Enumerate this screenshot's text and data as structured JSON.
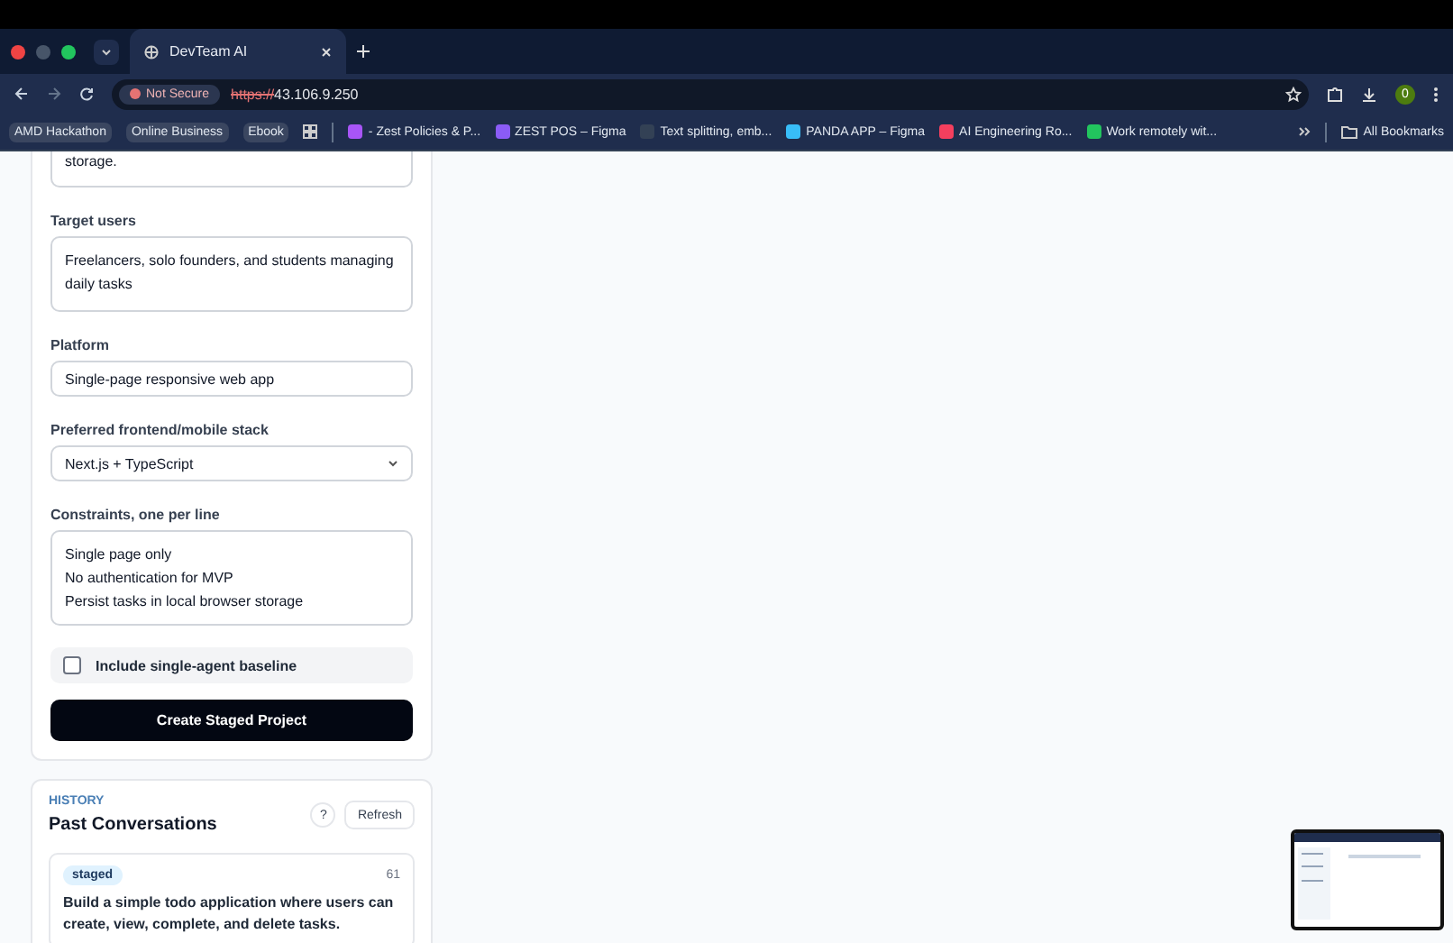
{
  "browser": {
    "tab": {
      "title": "DevTeam AI"
    },
    "security": "Not Secure",
    "url_scheme": "https://",
    "url_host": "43.106.9.250",
    "profile": "0",
    "bookmarks": [
      {
        "label": "AMD Hackathon",
        "kind": "chip"
      },
      {
        "label": "Online Business",
        "kind": "chip"
      },
      {
        "label": "Ebook",
        "kind": "chip"
      },
      {
        "label": "- Zest Policies & P...",
        "kind": "link"
      },
      {
        "label": "ZEST POS – Figma",
        "kind": "link"
      },
      {
        "label": "Text splitting, emb...",
        "kind": "link"
      },
      {
        "label": "PANDA APP – Figma",
        "kind": "link"
      },
      {
        "label": "AI Engineering Ro...",
        "kind": "link"
      },
      {
        "label": "Work remotely wit...",
        "kind": "link"
      }
    ],
    "all_bookmarks": "All Bookmarks"
  },
  "form": {
    "description_tail": "storage.",
    "fields": [
      {
        "label": "Target users",
        "kind": "textarea",
        "value": "Freelancers, solo founders, and students managing daily tasks"
      },
      {
        "label": "Platform",
        "kind": "input",
        "value": "Single-page responsive web app"
      },
      {
        "label": "Preferred frontend/mobile stack",
        "kind": "select",
        "value": "Next.js + TypeScript"
      },
      {
        "label": "Constraints, one per line",
        "kind": "lines",
        "lines": [
          "Single page only",
          "No authentication for MVP",
          "Persist tasks in local browser storage"
        ]
      }
    ],
    "baseline": {
      "label": "Include single-agent baseline",
      "checked": false
    },
    "submit": "Create Staged Project"
  },
  "history": {
    "eyebrow": "HISTORY",
    "title": "Past Conversations",
    "help": "?",
    "refresh": "Refresh",
    "items": [
      {
        "badge": "staged",
        "count": "61",
        "text": "Build a simple todo application where users can create, view, complete, and delete tasks."
      }
    ]
  }
}
